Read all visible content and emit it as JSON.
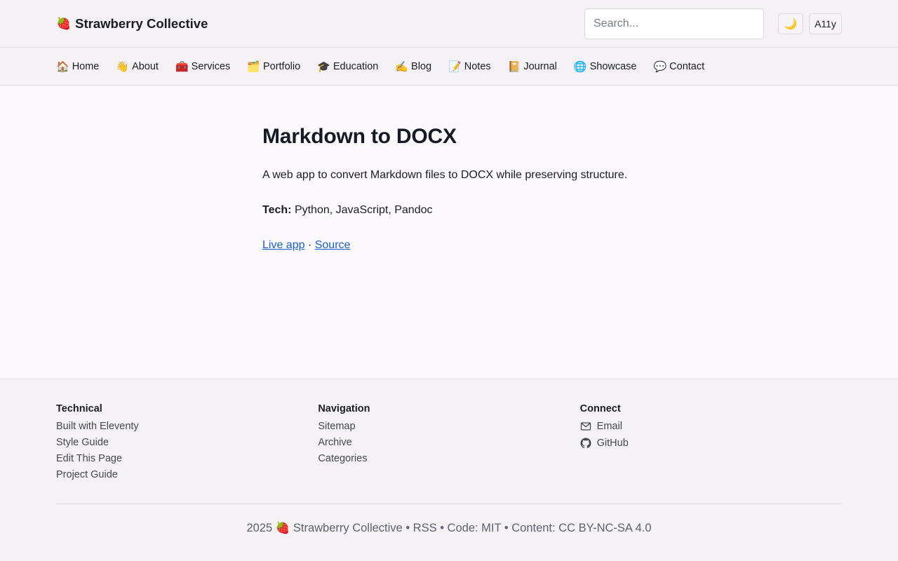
{
  "header": {
    "brand_emoji": "🍓",
    "brand_name": "Strawberry Collective",
    "search_placeholder": "Search...",
    "theme_toggle_icon": "🌙",
    "a11y_label": "A11y"
  },
  "nav": [
    {
      "emoji": "🏠",
      "label": "Home"
    },
    {
      "emoji": "👋",
      "label": "About"
    },
    {
      "emoji": "🧰",
      "label": "Services"
    },
    {
      "emoji": "🗂️",
      "label": "Portfolio"
    },
    {
      "emoji": "🎓",
      "label": "Education"
    },
    {
      "emoji": "✍️",
      "label": "Blog"
    },
    {
      "emoji": "📝",
      "label": "Notes"
    },
    {
      "emoji": "📔",
      "label": "Journal"
    },
    {
      "emoji": "🌐",
      "label": "Showcase"
    },
    {
      "emoji": "💬",
      "label": "Contact"
    }
  ],
  "main": {
    "title": "Markdown to DOCX",
    "description": "A web app to convert Markdown files to DOCX while preserving structure.",
    "tech_label": "Tech:",
    "tech_value": "Python, JavaScript, Pandoc",
    "live_link": "Live app",
    "separator": "·",
    "source_link": "Source"
  },
  "footer": {
    "technical": {
      "heading": "Technical",
      "links": [
        "Built with Eleventy",
        "Style Guide",
        "Edit This Page",
        "Project Guide"
      ]
    },
    "navigation": {
      "heading": "Navigation",
      "links": [
        "Sitemap",
        "Archive",
        "Categories"
      ]
    },
    "connect": {
      "heading": "Connect",
      "links": [
        {
          "icon": "mail-icon",
          "label": "Email"
        },
        {
          "icon": "github-icon",
          "label": "GitHub"
        }
      ]
    },
    "copyright": "2025 🍓 Strawberry Collective • RSS • Code: MIT • Content: CC BY-NC-SA 4.0"
  },
  "colors": {
    "background": "#fcf9fc",
    "chrome": "#f5f2f6",
    "link": "#1a5fd1",
    "text": "#1a1d24"
  }
}
